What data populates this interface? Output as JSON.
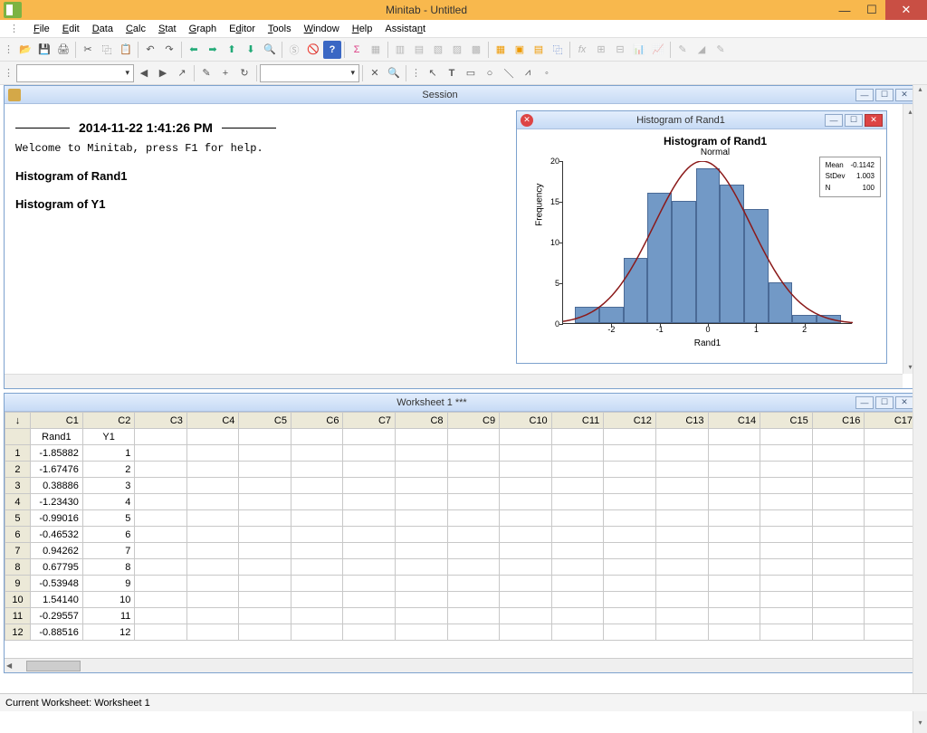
{
  "app": {
    "title": "Minitab - Untitled"
  },
  "menu": [
    "File",
    "Edit",
    "Data",
    "Calc",
    "Stat",
    "Graph",
    "Editor",
    "Tools",
    "Window",
    "Help",
    "Assistant"
  ],
  "session": {
    "title": "Session",
    "timestamp": "2014-11-22 1:41:26 PM",
    "welcome": "Welcome to Minitab, press F1 for help.",
    "h1": "Histogram of Rand1",
    "h2": "Histogram of Y1"
  },
  "histogram_window": {
    "title": "Histogram of Rand1"
  },
  "chart_data": {
    "type": "bar",
    "title": "Histogram of Rand1",
    "subtitle": "Normal",
    "xlabel": "Rand1",
    "ylabel": "Frequency",
    "ylim": [
      0,
      20
    ],
    "yticks": [
      0,
      5,
      10,
      15,
      20
    ],
    "xticks": [
      -2,
      -1,
      0,
      1,
      2
    ],
    "bin_centers": [
      -2.5,
      -2.0,
      -1.5,
      -1.0,
      -0.5,
      0.0,
      0.5,
      1.0,
      1.5,
      2.0,
      2.5
    ],
    "values": [
      2,
      2,
      8,
      16,
      15,
      19,
      17,
      14,
      5,
      1,
      1
    ],
    "stats": {
      "Mean": "-0.1142",
      "StDev": "1.003",
      "N": "100"
    },
    "overlay_curve": "normal"
  },
  "worksheet": {
    "title": "Worksheet 1 ***",
    "columns": [
      "C1",
      "C2",
      "C3",
      "C4",
      "C5",
      "C6",
      "C7",
      "C8",
      "C9",
      "C10",
      "C11",
      "C12",
      "C13",
      "C14",
      "C15",
      "C16",
      "C17"
    ],
    "names": [
      "Rand1",
      "Y1",
      "",
      "",
      "",
      "",
      "",
      "",
      "",
      "",
      "",
      "",
      "",
      "",
      "",
      "",
      ""
    ],
    "rows": [
      [
        "-1.85882",
        "1"
      ],
      [
        "-1.67476",
        "2"
      ],
      [
        "0.38886",
        "3"
      ],
      [
        "-1.23430",
        "4"
      ],
      [
        "-0.99016",
        "5"
      ],
      [
        "-0.46532",
        "6"
      ],
      [
        "0.94262",
        "7"
      ],
      [
        "0.67795",
        "8"
      ],
      [
        "-0.53948",
        "9"
      ],
      [
        "1.54140",
        "10"
      ],
      [
        "-0.29557",
        "11"
      ],
      [
        "-0.88516",
        "12"
      ]
    ]
  },
  "status": "Current Worksheet: Worksheet 1"
}
